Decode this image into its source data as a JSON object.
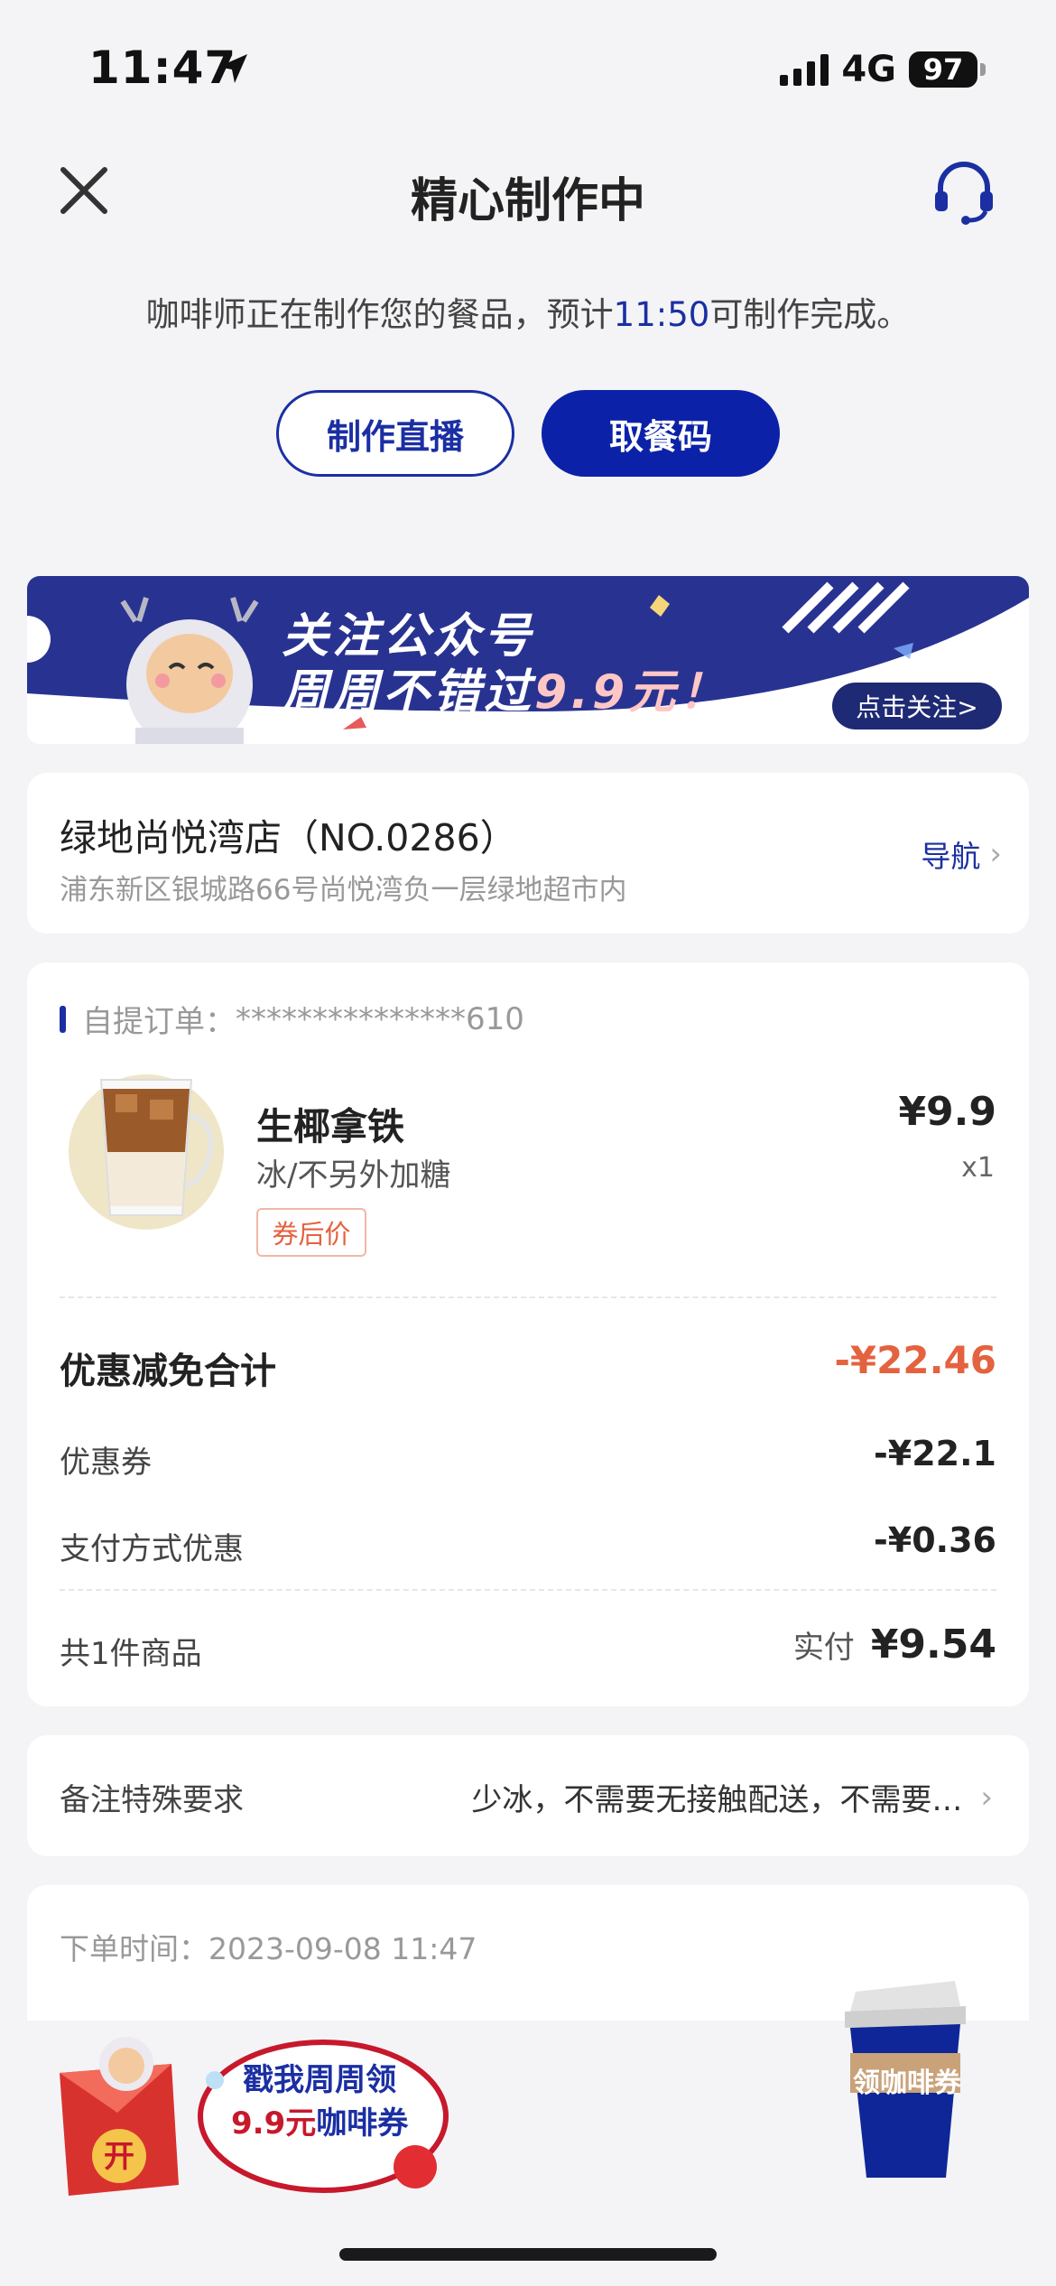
{
  "status_bar": {
    "time": "11:47",
    "network": "4G",
    "battery": "97"
  },
  "header": {
    "title": "精心制作中"
  },
  "status_message": {
    "prefix": "咖啡师正在制作您的餐品，预计",
    "time": "11:50",
    "suffix": "可制作完成。"
  },
  "buttons": {
    "live": "制作直播",
    "pickup_code": "取餐码"
  },
  "banner": {
    "line1": "关注公众号",
    "line2_prefix": "周周不错过",
    "line2_highlight": "9.9元！",
    "follow": "点击关注>"
  },
  "store": {
    "name": "绿地尚悦湾店（NO.0286）",
    "address": "浦东新区银城路66号尚悦湾负一层绿地超市内",
    "nav": "导航"
  },
  "order": {
    "label": "自提订单：",
    "number": "***************610",
    "product": {
      "name": "生椰拿铁",
      "spec": "冰/不另外加糖",
      "tag": "券后价",
      "price": "¥9.9",
      "qty": "x1"
    },
    "discount_total": {
      "label": "优惠减免合计",
      "value": "-¥22.46"
    },
    "coupon": {
      "label": "优惠券",
      "value": "-¥22.1"
    },
    "payment_discount": {
      "label": "支付方式优惠",
      "value": "-¥0.36"
    },
    "summary": {
      "count": "共1件商品",
      "paid_label": "实付",
      "paid_value": "¥9.54"
    }
  },
  "remark": {
    "label": "备注特殊要求",
    "value": "少冰，不需要无接触配送，不需要…"
  },
  "order_time": {
    "label": "下单时间：",
    "value": "2023-09-08 11:47"
  },
  "promo": {
    "line1": "戳我周周领",
    "line2_red": "9.9元",
    "line2_blue": "咖啡券",
    "open": "开",
    "cup_label": "领咖啡券"
  },
  "colors": {
    "brand_blue": "#0b22a8",
    "discount_red": "#e4623f",
    "background": "#f4f4f6"
  }
}
